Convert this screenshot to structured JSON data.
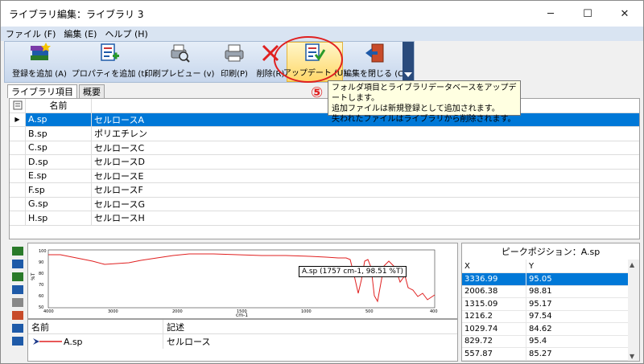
{
  "window": {
    "title": "ライブラリ編集：ライブラリ 3",
    "minimize": "─",
    "maximize": "☐",
    "close": "✕"
  },
  "menu": [
    "ファイル (F)",
    "編集 (E)",
    "ヘルプ (H)"
  ],
  "toolbar": {
    "add": "登録を追加 (A)",
    "add_props": "プロパティを追加 (t)",
    "preview": "印刷プレビュー (v)",
    "print": "印刷(P)",
    "delete": "削除(R)",
    "update": "アップデート (U)",
    "close_edit": "編集を閉じる (C)"
  },
  "annotation": {
    "number": "⑤"
  },
  "tooltip": {
    "line1": "フォルダ項目とライブラリデータベースをアップデートします。",
    "line2": "追加ファイルは新規登録として追加されます。",
    "line3": "失われたファイルはライブラリから削除されます。"
  },
  "tabs": [
    "ライブラリ項目",
    "概要"
  ],
  "grid": {
    "header": "名前",
    "rows": [
      {
        "file": "A.sp",
        "name": "セルロースA"
      },
      {
        "file": "B.sp",
        "name": "ポリエチレン"
      },
      {
        "file": "C.sp",
        "name": "セルロースC"
      },
      {
        "file": "D.sp",
        "name": "セルロースD"
      },
      {
        "file": "E.sp",
        "name": "セルロースE"
      },
      {
        "file": "F.sp",
        "name": "セルロースF"
      },
      {
        "file": "G.sp",
        "name": "セルロースG"
      },
      {
        "file": "H.sp",
        "name": "セルロースH"
      }
    ]
  },
  "chart": {
    "tooltip": "A.sp (1757 cm-1, 98.51 %T)",
    "ylabel": "%T",
    "xlabel": "cm-1",
    "x_ticks": [
      "4000",
      "3000",
      "2000",
      "1500",
      "1000",
      "500",
      "400"
    ],
    "y_ticks": [
      "100",
      "90",
      "80",
      "70",
      "60",
      "50"
    ],
    "line_color": "#e02020"
  },
  "legend": {
    "col1": "名前",
    "col2": "記述",
    "item_name": "A.sp",
    "item_desc": "セルロース"
  },
  "peaks": {
    "title": "ピークポジション：A.sp",
    "col_x": "X",
    "col_y": "Y",
    "rows": [
      {
        "x": "3336.99",
        "y": "95.05"
      },
      {
        "x": "2006.38",
        "y": "98.81"
      },
      {
        "x": "1315.09",
        "y": "95.17"
      },
      {
        "x": "1216.2",
        "y": "97.54"
      },
      {
        "x": "1029.74",
        "y": "84.62"
      },
      {
        "x": "829.72",
        "y": "95.4"
      },
      {
        "x": "557.87",
        "y": "85.27"
      }
    ]
  },
  "colors": {
    "selection": "#0078d7",
    "annotation_red": "#e02020",
    "toolbar_dark": "#2a4b7c"
  }
}
